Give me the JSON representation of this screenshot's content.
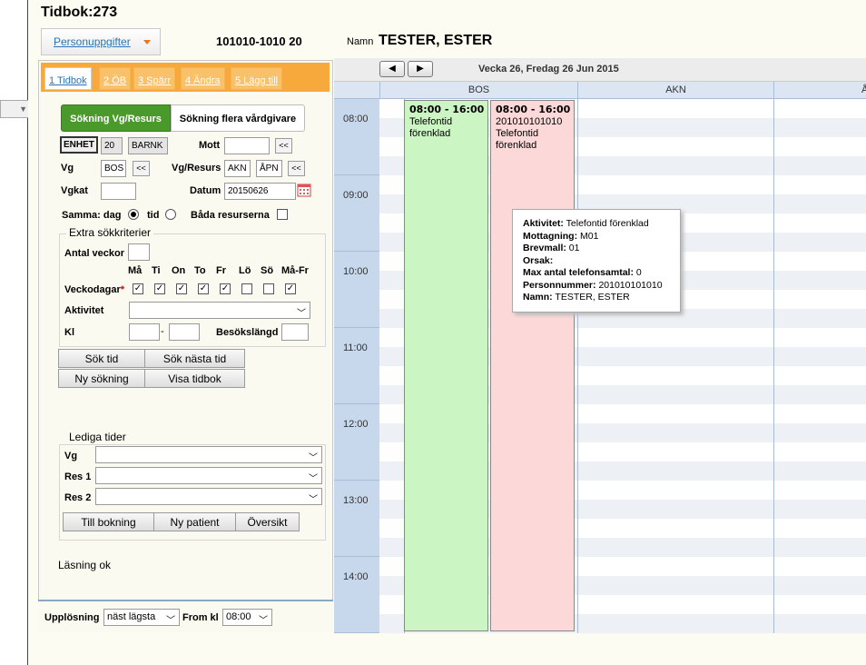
{
  "window": {
    "title": "Tidbok:273"
  },
  "header": {
    "person_button": "Personuppgifter",
    "person_number": "101010-1010 20",
    "name_label": "Namn",
    "name_value": "TESTER, ESTER"
  },
  "tabs": [
    {
      "label": "1 Tidbok",
      "active": true
    },
    {
      "label": "2 ÖB",
      "active": false
    },
    {
      "label": "3 Spärr",
      "active": false
    },
    {
      "label": "4 Ändra",
      "active": false
    },
    {
      "label": "5 Lägg till",
      "active": false
    }
  ],
  "search_modes": {
    "vg_resurs": "Sökning Vg/Resurs",
    "multi": "Sökning flera vårdgivare"
  },
  "form": {
    "enhet_label": "ENHET",
    "enhet_code": "20",
    "enhet_name": "BARNK",
    "mott_label": "Mott",
    "mott_value": "",
    "vg_label": "Vg",
    "vg_value": "BOS",
    "vgresurs_label": "Vg/Resurs",
    "vgresurs_value1": "AKN",
    "vgresurs_value2": "ÅPN",
    "vgkat_label": "Vgkat",
    "vgkat_value": "",
    "datum_label": "Datum",
    "datum_value": "20150626",
    "samma_label": "Samma: dag",
    "tid_label": "tid",
    "bada_label": "Båda resurserna",
    "arrow_label": "<<"
  },
  "extra": {
    "legend": "Extra sökkriterier",
    "antal_veckor_label": "Antal veckor",
    "days": [
      "Må",
      "Ti",
      "On",
      "To",
      "Fr",
      "Lö",
      "Sö",
      "Må-Fr"
    ],
    "days_checked": [
      true,
      true,
      true,
      true,
      true,
      false,
      false,
      true
    ],
    "veckodagar_label": "Veckodagar",
    "required_mark": "*",
    "aktivitet_label": "Aktivitet",
    "kl_label": "Kl",
    "kl_sep": "-",
    "besokslangd_label": "Besökslängd"
  },
  "buttons": {
    "sok_tid": "Sök tid",
    "sok_nasta": "Sök nästa tid",
    "ny_sokning": "Ny sökning",
    "visa_tidbok": "Visa tidbok",
    "till_bokning": "Till bokning",
    "ny_patient": "Ny patient",
    "oversikt": "Översikt"
  },
  "lediga": {
    "legend": "Lediga tider",
    "vg_label": "Vg",
    "res1_label": "Res 1",
    "res2_label": "Res 2"
  },
  "status_text": "Läsning ok",
  "footer": {
    "upplosning_label": "Upplösning",
    "upplosning_value": "näst lägsta",
    "from_label": "From kl",
    "from_value": "08:00"
  },
  "calendar": {
    "week_label": "Vecka 26, Fredag 26 Jun 2015",
    "columns": [
      "BOS",
      "AKN",
      "Å"
    ],
    "hours": [
      "08:00",
      "09:00",
      "10:00",
      "11:00",
      "12:00",
      "13:00",
      "14:00"
    ],
    "appointments": [
      {
        "time": "08:00 - 16:00",
        "line1": "Telefontid",
        "line2": "förenklad",
        "line3": "",
        "color": "#ccf5c4"
      },
      {
        "time": "08:00 - 16:00",
        "line1": "201010101010",
        "line2": "Telefontid",
        "line3": "förenklad",
        "color": "#fcd8d8"
      }
    ]
  },
  "tooltip": {
    "aktivitet_label": "Aktivitet:",
    "aktivitet": "Telefontid förenklad",
    "mottagning_label": "Mottagning:",
    "mottagning": "M01",
    "brevmall_label": "Brevmall:",
    "brevmall": "01",
    "orsak_label": "Orsak:",
    "orsak": "",
    "max_label": "Max antal telefonsamtal:",
    "max": "0",
    "pnr_label": "Personnummer:",
    "pnr": "201010101010",
    "namn_label": "Namn:",
    "namn": "TESTER, ESTER"
  },
  "icons": {
    "calendar": "calendar-icon",
    "prev": "arrow-left-icon",
    "next": "arrow-right-icon",
    "dropdown": "chevron-down-icon"
  }
}
